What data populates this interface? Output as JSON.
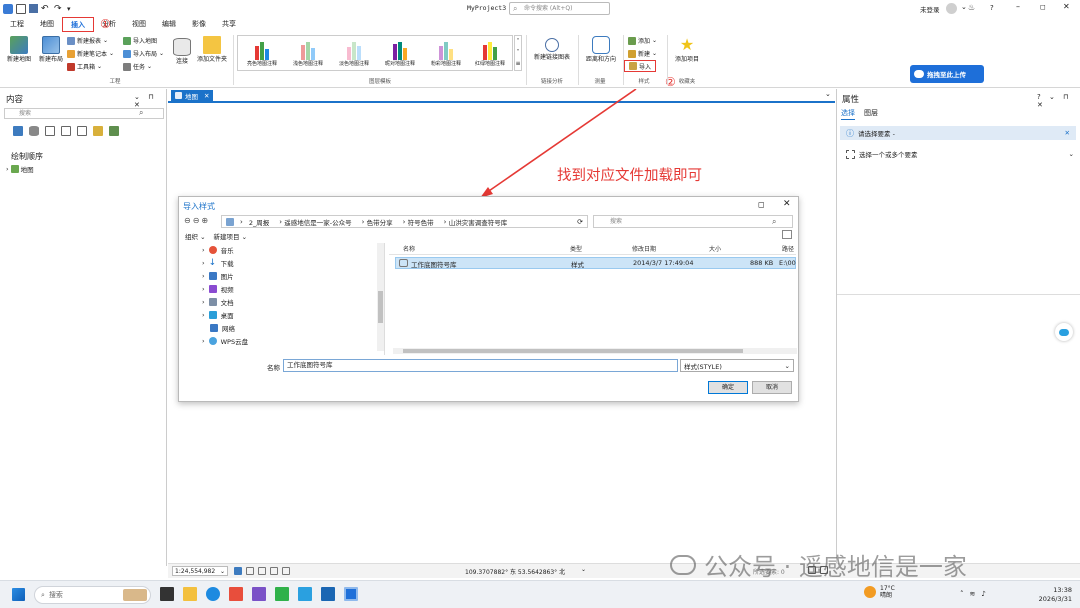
{
  "window": {
    "title": "MyProject3",
    "search_placeholder": "命令搜索 (Alt+Q)",
    "user": "未登录",
    "help": "?"
  },
  "menu": [
    {
      "label": "工程"
    },
    {
      "label": "地图"
    },
    {
      "label": "插入"
    },
    {
      "label": "分析"
    },
    {
      "label": "视图"
    },
    {
      "label": "编辑"
    },
    {
      "label": "影像"
    },
    {
      "label": "共享"
    }
  ],
  "annotations": {
    "circle1": "①",
    "circle2": "②",
    "arrow_text": "找到对应文件加载即可"
  },
  "ribbon": {
    "new_map": "新建地图",
    "new_layout": "新建布局",
    "new_report": "新建报表",
    "new_notebook": "新建笔记本",
    "toolbox": "工具箱",
    "import_map": "导入地图",
    "import_layout": "导入布局",
    "task": "任务",
    "connect": "连接",
    "add_folder": "添加文件夹",
    "group_project": "工程",
    "gallery": [
      "亮色地图注释",
      "浅色地图注释",
      "淡色地图注释",
      "昵对地图注释",
      "粉彩地图注释",
      "红绿地图注释"
    ],
    "group_layer_template": "图层模板",
    "new_link_chart": "新建链接图表",
    "group_link_analysis": "链接分析",
    "distance_direction": "距离和方向",
    "group_measure": "测量",
    "style_add": "添加",
    "style_new": "新建",
    "style_import": "导入",
    "group_style": "样式",
    "add_item": "添加项目",
    "group_favorites": "收藏夹",
    "upload_button": "拖拽至此上传"
  },
  "contents": {
    "title": "内容",
    "search_placeholder": "搜索",
    "drawing_order": "绘制顺序",
    "map_item": "地图"
  },
  "map_tab": {
    "label": "地图"
  },
  "properties": {
    "title": "属性",
    "tab_select": "选择",
    "tab_layer": "图层",
    "info": "请选择要素 -",
    "select_hint": "选择一个或多个要素"
  },
  "dialog": {
    "title": "导入样式",
    "path": [
      "2_周报",
      "遥感地信是一家-公众号",
      "色带分享",
      "符号色带",
      "山洪灾害调查符号库"
    ],
    "search_placeholder": "搜索",
    "organize": "组织",
    "new_item": "新建项目",
    "tree": [
      "音乐",
      "下载",
      "图片",
      "视频",
      "文档",
      "桌面",
      "网络",
      "WPS云盘"
    ],
    "columns": {
      "name": "名称",
      "type": "类型",
      "modified": "修改日期",
      "size": "大小",
      "path": "路径"
    },
    "file": {
      "name": "工作底图符号库",
      "type": "样式",
      "modified": "2014/3/7 17:49:04",
      "size": "888 KB",
      "path": "E:\\00"
    },
    "name_label": "名称",
    "name_value": "工作底图符号库",
    "filter": "样式(STYLE)",
    "ok": "确定",
    "cancel": "取消"
  },
  "status": {
    "scale": "1:24,554,982",
    "coords": "109.3707882° 东 53.5642863° 北",
    "selected": "所选要素: 0"
  },
  "watermark": "公众号 · 遥感地信是一家",
  "taskbar": {
    "search": "搜索",
    "weather_temp": "17°C",
    "weather_desc": "晴朗",
    "time": "13:38",
    "date": "2026/3/31"
  },
  "colors": {
    "accent": "#1e6fd9",
    "annotation_red": "#e53935",
    "map_tab": "#1b72c9"
  }
}
